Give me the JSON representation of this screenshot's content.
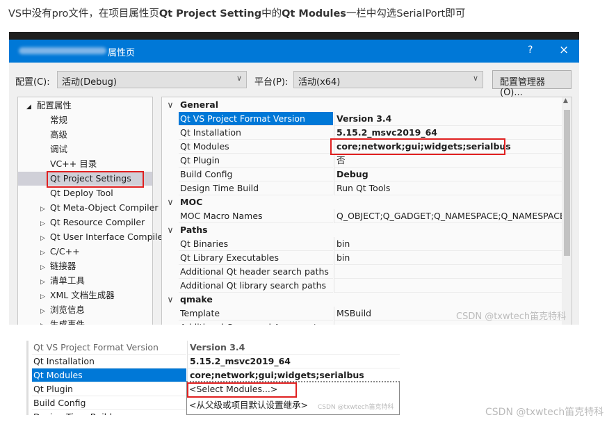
{
  "intro": {
    "p1": "VS中没有pro文件，在项目属性页",
    "b1": "Qt Project Setting",
    "p2": "中的",
    "b2": "Qt Modules",
    "p3": "一栏中勾选SerialPort即可"
  },
  "dialog": {
    "title": "属性页",
    "help": "?",
    "close": "×",
    "config_label": "配置(C):",
    "config_value": "活动(Debug)",
    "platform_label": "平台(P):",
    "platform_value": "活动(x64)",
    "manager_button": "配置管理器(O)..."
  },
  "tree": {
    "root": "配置属性",
    "items": [
      "常规",
      "高级",
      "调试",
      "VC++ 目录",
      "Qt Project Settings",
      "Qt Deploy Tool"
    ],
    "expandable": [
      "Qt Meta-Object Compiler",
      "Qt Resource Compiler",
      "Qt User Interface Compiler",
      "C/C++",
      "链接器",
      "清单工具",
      "XML 文档生成器",
      "浏览信息",
      "生成事件"
    ]
  },
  "grid": {
    "rows": [
      {
        "cat": "General"
      },
      {
        "n": "Qt VS Project Format Version",
        "v": "Version 3.4",
        "bold": true
      },
      {
        "n": "Qt Installation",
        "v": "5.15.2_msvc2019_64",
        "bold": true
      },
      {
        "n": "Qt Modules",
        "v": "core;network;gui;widgets;serialbus",
        "bold": true
      },
      {
        "n": "Qt Plugin",
        "v": "否"
      },
      {
        "n": "Build Config",
        "v": "Debug",
        "bold": true
      },
      {
        "n": "Design Time Build",
        "v": "Run Qt Tools"
      },
      {
        "cat": "MOC"
      },
      {
        "n": "MOC Macro Names",
        "v": "Q_OBJECT;Q_GADGET;Q_NAMESPACE;Q_NAMESPACE_EXPORT"
      },
      {
        "cat": "Paths"
      },
      {
        "n": "Qt Binaries",
        "v": "bin"
      },
      {
        "n": "Qt Library Executables",
        "v": "bin"
      },
      {
        "n": "Additional Qt header search paths",
        "v": ""
      },
      {
        "n": "Additional Qt library search paths",
        "v": ""
      },
      {
        "cat": "qmake"
      },
      {
        "n": "Template",
        "v": "MSBuild"
      },
      {
        "n": "Additional Command Arguments",
        "v": ""
      }
    ]
  },
  "watermark": "CSDN @txwtech笛克特科",
  "shot2": {
    "rows": [
      {
        "n": "Qt VS Project Format Version",
        "v": "Version 3.4"
      },
      {
        "n": "Qt Installation",
        "v": "5.15.2_msvc2019_64"
      },
      {
        "n": "Qt Modules",
        "v": "core;network;gui;widgets;serialbus"
      },
      {
        "n": "Qt Plugin",
        "v": ""
      },
      {
        "n": "Build Config",
        "v": ""
      },
      {
        "n": "Design Time Build",
        "v": ""
      }
    ],
    "options": [
      "<Select Modules...>",
      "<从父级或项目默认设置继承>"
    ],
    "small_watermark": "CSDN @txwtech笛克特科"
  }
}
